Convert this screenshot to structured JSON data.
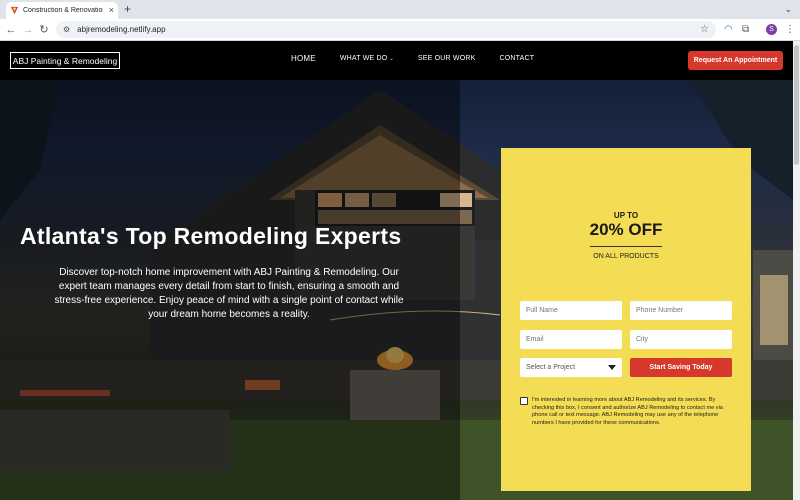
{
  "browser": {
    "tab_title": "Construction & Renovation Se",
    "new_tab_label": "+",
    "url": "abjremodeling.netlify.app",
    "profile_initial": "S"
  },
  "nav": {
    "logo": "ABJ Painting & Remodeling",
    "links": [
      "HOME",
      "WHAT WE DO",
      "SEE OUR WORK",
      "CONTACT"
    ],
    "cta": "Request An Appointment"
  },
  "hero": {
    "title": "Atlanta's Top Remodeling Experts",
    "text": "Discover top-notch home improvement with ABJ Painting & Remodeling. Our expert team manages every detail from start to finish, ensuring a smooth and stress-free experience. Enjoy peace of mind with a single point of contact while your dream home becomes a reality."
  },
  "form": {
    "promo_upto": "UP TO",
    "promo_off": "20% OFF",
    "promo_sub": "ON ALL PRODUCTS",
    "full_name_placeholder": "Full Name",
    "phone_placeholder": "Phone Number",
    "email_placeholder": "Email",
    "city_placeholder": "City",
    "project_select": "Select a Project",
    "submit": "Start Saving Today",
    "consent": "I'm interested in learning more about ABJ Remodeling and its services. By checking this box, I consent and authorize ABJ Remodeling to contact me via phone call or text message. ABJ Remodeling may use any of the telephone numbers I have provided for these communications."
  },
  "colors": {
    "accent_red": "#d6392c",
    "form_yellow": "#f4dc55",
    "nav_black": "#000000"
  }
}
